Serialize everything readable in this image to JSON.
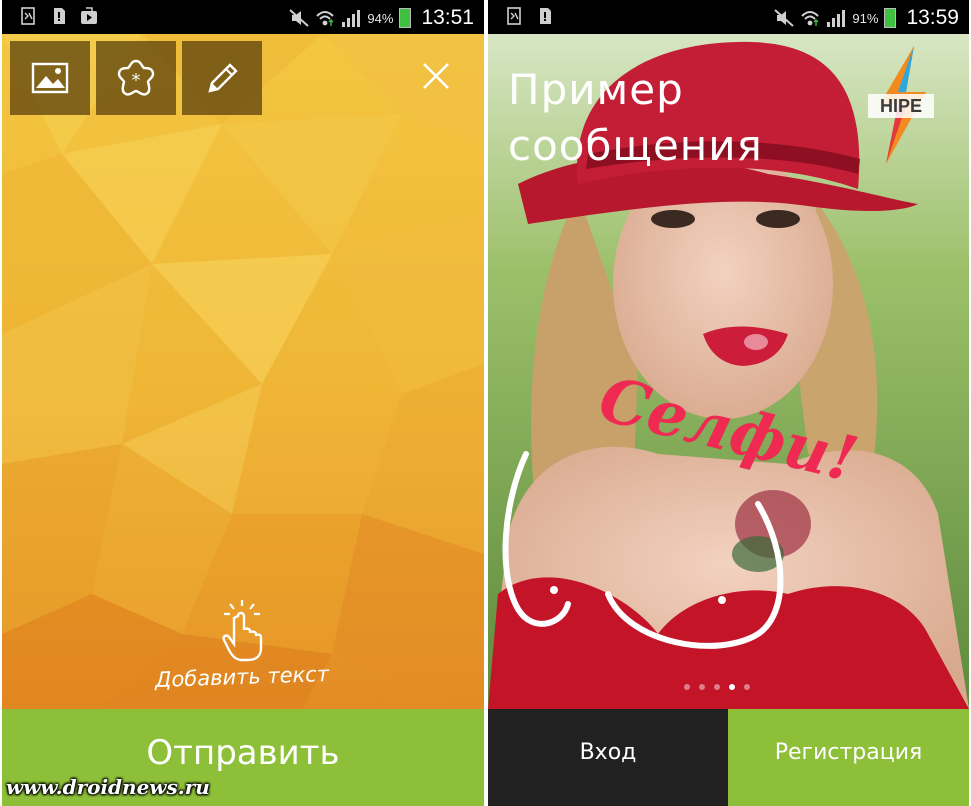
{
  "left_screen": {
    "status_bar": {
      "battery_percent": "94%",
      "time": "13:51",
      "icons": [
        "screenshot-icon",
        "sd-card-icon",
        "play-store-icon",
        "mute-icon",
        "wifi-icon",
        "signal-icon",
        "battery-icon"
      ]
    },
    "toolbar": {
      "items": [
        "image-icon",
        "sticker-icon",
        "pencil-icon"
      ],
      "close_icon": "close-icon"
    },
    "add_text_label": "Добавить текст",
    "send_button_label": "Отправить",
    "colors": {
      "background_top": "#f2c23e",
      "background_bottom": "#e08a22",
      "accent": "#8dbf38"
    }
  },
  "right_screen": {
    "status_bar": {
      "battery_percent": "91%",
      "time": "13:59",
      "icons": [
        "screenshot-icon",
        "sd-card-icon",
        "mute-icon",
        "wifi-icon",
        "signal-icon",
        "battery-icon"
      ]
    },
    "message_title_line1": "Пример",
    "message_title_line2": "сообщения",
    "overlay_text": "Селфи!",
    "logo_text": "HIPE",
    "page_dots": {
      "count": 5,
      "active_index": 3
    },
    "login_label": "Вход",
    "register_label": "Регистрация",
    "colors": {
      "overlay_text": "#ee2a52",
      "login_bg": "#212121",
      "register_bg": "#8dbf38"
    }
  },
  "watermark": "www.droidnews.ru"
}
